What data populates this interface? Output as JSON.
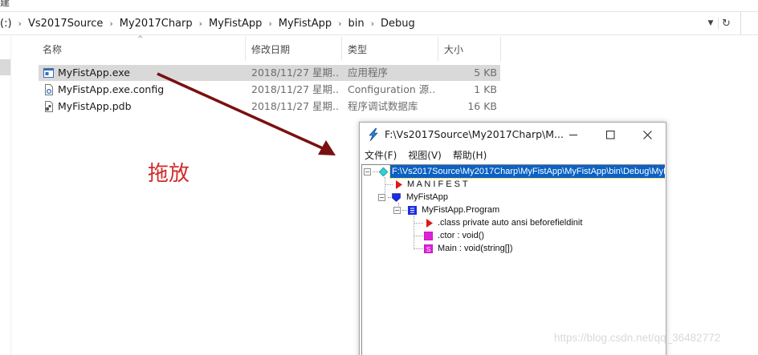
{
  "top_fragment": "建",
  "address": {
    "crumbs": [
      "(:)",
      "Vs2017Source",
      "My2017Charp",
      "MyFistApp",
      "MyFistApp",
      "bin",
      "Debug"
    ],
    "separator": "›"
  },
  "columns": {
    "name": "名称",
    "date": "修改日期",
    "type": "类型",
    "size": "大小"
  },
  "files": [
    {
      "name": "MyFistApp.exe",
      "date": "2018/11/27 星期...",
      "type": "应用程序",
      "size": "5 KB",
      "selected": true,
      "icon": "exe-icon"
    },
    {
      "name": "MyFistApp.exe.config",
      "date": "2018/11/27 星期...",
      "type": "Configuration 源...",
      "size": "1 KB",
      "selected": false,
      "icon": "config-file-icon"
    },
    {
      "name": "MyFistApp.pdb",
      "date": "2018/11/27 星期...",
      "type": "程序调试数据库",
      "size": "16 KB",
      "selected": false,
      "icon": "pdb-file-icon"
    }
  ],
  "drag_label": "拖放",
  "ildasm": {
    "title": "F:\\Vs2017Source\\My2017Charp\\M...",
    "menu": [
      "文件(F)",
      "视图(V)",
      "帮助(H)"
    ],
    "tree": {
      "root": "F:\\Vs2017Source\\My2017Charp\\MyFistApp\\MyFistApp\\bin\\Debug\\MyFi",
      "manifest": "M A N I F E S T",
      "namespace": "MyFistApp",
      "class": "MyFistApp.Program",
      "class_decl": ".class private auto ansi beforefieldinit",
      "ctor": ".ctor : void()",
      "main": "Main : void(string[])"
    }
  },
  "watermark": "https://blog.csdn.net/qq_36482772",
  "colors": {
    "selection_bg": "#d9d9d9",
    "tree_selection": "#0b61c4",
    "arrow": "#7a1010",
    "drag_label": "#d12a2a"
  }
}
